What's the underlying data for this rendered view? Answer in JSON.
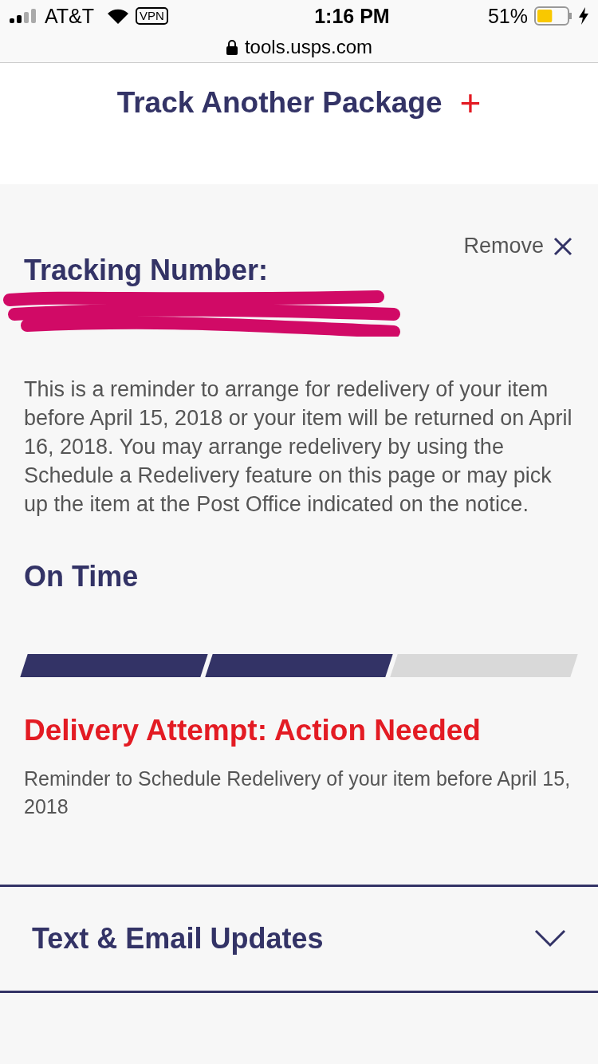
{
  "status_bar": {
    "carrier": "AT&T",
    "vpn": "VPN",
    "time": "1:16 PM",
    "battery": "51%",
    "charging": true
  },
  "address_bar": {
    "url": "tools.usps.com",
    "secure": true
  },
  "track_another": {
    "label": "Track Another Package",
    "icon": "+"
  },
  "tracking": {
    "remove_label": "Remove",
    "title": "Tracking Number:",
    "number_redacted": true,
    "message": "This is a reminder to arrange for redelivery of your item before April 15, 2018 or your item will be returned on April 16, 2018. You may arrange redelivery by using the Schedule a Redelivery feature on this page or may pick up the item at the Post Office indicated on the notice.",
    "status": "On Time",
    "progress": [
      {
        "filled": true
      },
      {
        "filled": true
      },
      {
        "filled": false
      }
    ],
    "headline": "Delivery Attempt: Action Needed",
    "detail": "Reminder to Schedule Redelivery of your item before April 15, 2018"
  },
  "sections": [
    {
      "title": "Text & Email Updates",
      "expanded": false
    }
  ]
}
